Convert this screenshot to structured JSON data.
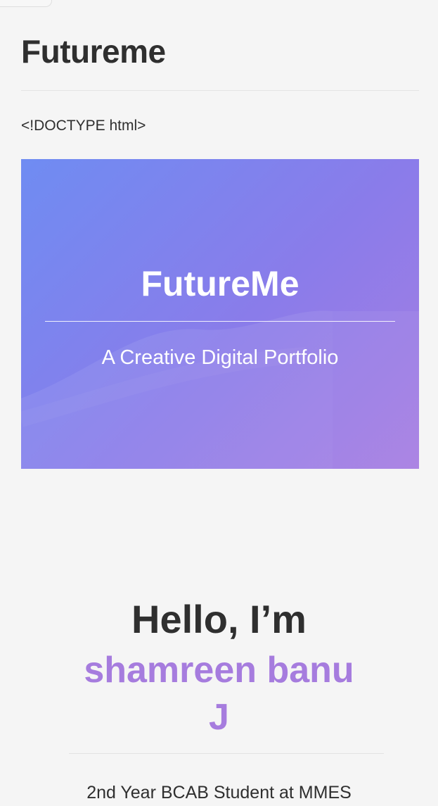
{
  "page": {
    "title": "Futureme",
    "doctype_text": "<!DOCTYPE html>"
  },
  "hero": {
    "title": "FutureMe",
    "subtitle": "A Creative Digital Portfolio"
  },
  "intro": {
    "hello": "Hello, I’m",
    "name_line_1": "shamreen banu",
    "name_line_2": "J",
    "description": "2nd Year BCAB Student at MMES"
  },
  "colors": {
    "background": "#f5f5f5",
    "text": "#2f2f2f",
    "accent": "#a67cde",
    "hero_gradient_start": "#6f8cf2",
    "hero_gradient_end": "#a77ee2"
  }
}
